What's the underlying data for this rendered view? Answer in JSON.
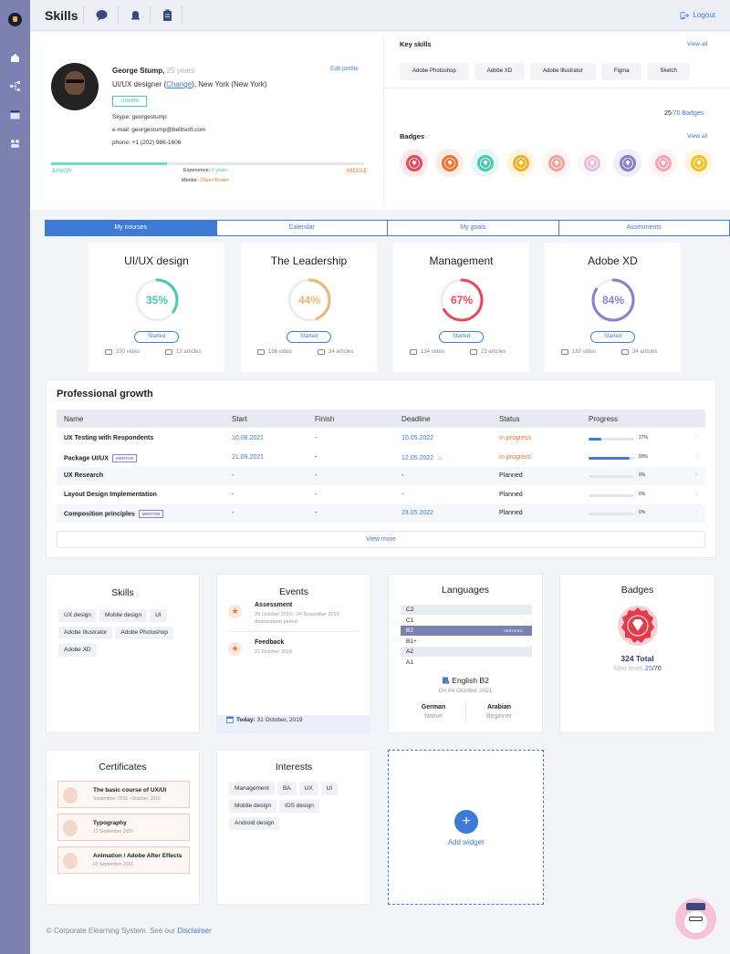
{
  "topbar": {
    "title": "Skills",
    "logout": "Logout"
  },
  "profile": {
    "name": "George Stump,",
    "age": "25 years",
    "role": "UI/UX designer",
    "change": "Change",
    "location": "New York (New York)",
    "level_tag": "JUNIOR",
    "edit": "Edit profile",
    "skype": "Skype: georgestump",
    "email": "e-mail: georgestump@belitsoft.com",
    "phone": "phone: +1 (202) 986-1606",
    "level_left": "JUNIOR",
    "level_right": "MIDDLE",
    "experience_label": "Experience:",
    "experience_value": "2 years",
    "mentor_label": "Mentor:",
    "mentor_value": "Oliver Brown",
    "experience_progress": 0.37
  },
  "key_skills": {
    "title": "Key skills",
    "view_all": "View all",
    "items": [
      "Adobe Photoshop",
      "Adobe XD",
      "Adobe Illustrator",
      "Figma",
      "Sketch"
    ]
  },
  "badges_panel": {
    "count": "25",
    "sep": "/",
    "total": "70",
    "label": "Badges",
    "title": "Badges",
    "view_all": "View all",
    "colors": [
      "#e8495a",
      "#f0732f",
      "#47c9b4",
      "#f2b01e",
      "#f2a49a",
      "#e6c2d6",
      "#8a7fcf",
      "#f2a6b0",
      "#f2c11e"
    ]
  },
  "tabs": [
    "My courses",
    "Calendar",
    "My goals",
    "Assesments"
  ],
  "courses": [
    {
      "name": "UI/UX design",
      "pct": 35,
      "pct_label": "35%",
      "color": "#47c9b4",
      "status": "Started",
      "videos": "230 video",
      "articles": "13 articles"
    },
    {
      "name": "The Leadership",
      "pct": 44,
      "pct_label": "44%",
      "color": "#f0b473",
      "status": "Started",
      "videos": "156 video",
      "articles": "34 articles"
    },
    {
      "name": "Management",
      "pct": 67,
      "pct_label": "67%",
      "color": "#e8495a",
      "status": "Started",
      "videos": "134 video",
      "articles": "23 articles"
    },
    {
      "name": "Adobe XD",
      "pct": 84,
      "pct_label": "84%",
      "color": "#8a7fcf",
      "status": "Started",
      "videos": "160 video",
      "articles": "34 articles"
    }
  ],
  "growth": {
    "title": "Professional growth",
    "headers": [
      "Name",
      "Start",
      "Finish",
      "Deadline",
      "Status",
      "Progress"
    ],
    "rows": [
      {
        "name": "UX Testing with Respondents",
        "tag": "",
        "start": "10.08.2021",
        "finish": "-",
        "deadline": "10.05.2022",
        "status": "In progress",
        "progress": 0.27,
        "progress_label": "27%"
      },
      {
        "name": "Package UI/UX",
        "tag": "MENTOR",
        "start": "21.09.2021",
        "finish": "-",
        "deadline": "12.05.2022",
        "status": "In progress",
        "progress": 0.9,
        "progress_label": "90%"
      },
      {
        "name": "UX Research",
        "tag": "",
        "start": "-",
        "finish": "-",
        "deadline": "-",
        "status": "Planned",
        "progress": 0,
        "progress_label": "0%"
      },
      {
        "name": "Layout Design Implementation",
        "tag": "",
        "start": "-",
        "finish": "-",
        "deadline": "-",
        "status": "Planned",
        "progress": 0,
        "progress_label": "0%"
      },
      {
        "name": "Composition principles",
        "tag": "MENTOR",
        "start": "-",
        "finish": "-",
        "deadline": "23.05.2022",
        "status": "Planned",
        "progress": 0,
        "progress_label": "0%"
      }
    ],
    "view_more": "View more"
  },
  "skills_card": {
    "title": "Skills",
    "items": [
      "UX design",
      "Mobile design",
      "UI",
      "Adobe Illustrator",
      "Adobe Photoshop",
      "Adobe XD"
    ]
  },
  "events_card": {
    "title": "Events",
    "items": [
      {
        "title": "Assessment",
        "date": "29 October 2019 - 24 November 2019",
        "desc": "Assessment period"
      },
      {
        "title": "Feedback",
        "date": "21 October 2019",
        "desc": ""
      }
    ],
    "today_label": "Today:",
    "today_date": "31 October, 2019"
  },
  "languages_card": {
    "title": "Languages",
    "levels": [
      "C2",
      "C1",
      "B2",
      "B1+",
      "A2",
      "A1"
    ],
    "certified": "CERTIFIED",
    "current": "English B2",
    "current_date": "On 04 October 2021",
    "others": [
      {
        "name": "German",
        "level": "Native"
      },
      {
        "name": "Arabian",
        "level": "Beginner"
      }
    ]
  },
  "badges_card": {
    "title": "Badges",
    "total": "324 Total",
    "next_label": "Next level:",
    "next_value": "25",
    "next_sep": "/",
    "next_total": "70"
  },
  "certificates_card": {
    "title": "Certificates",
    "items": [
      {
        "title": "The basic course of UX/UI",
        "date": "September, 2016 - October, 2016"
      },
      {
        "title": "Typography",
        "date": "12 September 2016"
      },
      {
        "title": "Animation / Adobe After Effects",
        "date": "03 September 2016"
      }
    ]
  },
  "interests_card": {
    "title": "Interests",
    "items": [
      "Management",
      "BA",
      "UX",
      "UI",
      "Mobile design",
      "iOS design",
      "Android design"
    ]
  },
  "add_widget": {
    "plus": "+",
    "label": "Add widget"
  },
  "footer": {
    "copy": "© Corporate Elearning System.  See our",
    "link": "Disclaimer"
  }
}
